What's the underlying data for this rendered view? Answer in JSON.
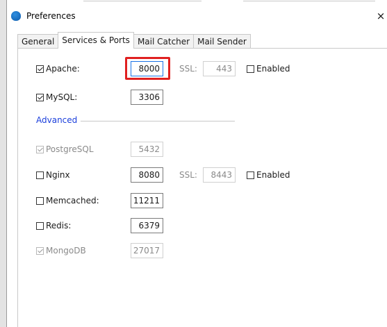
{
  "window": {
    "title": "Preferences",
    "close_glyph": "×",
    "app_icon": "app-logo-icon"
  },
  "tabs": [
    {
      "label": "General",
      "active": false
    },
    {
      "label": "Services & Ports",
      "active": true
    },
    {
      "label": "Mail Catcher",
      "active": false
    },
    {
      "label": "Mail Sender",
      "active": false
    }
  ],
  "services": {
    "apache": {
      "label": "Apache:",
      "checked": true,
      "port": "8000",
      "ssl_label": "SSL:",
      "ssl_port": "443",
      "enabled_label": "Enabled",
      "ssl_enabled": false
    },
    "mysql": {
      "label": "MySQL:",
      "checked": true,
      "port": "3306"
    }
  },
  "advanced": {
    "section_label": "Advanced",
    "postgresql": {
      "label": "PostgreSQL",
      "checked": true,
      "disabled": true,
      "port": "5432"
    },
    "nginx": {
      "label": "Nginx",
      "checked": false,
      "port": "8080",
      "ssl_label": "SSL:",
      "ssl_port": "8443",
      "enabled_label": "Enabled",
      "ssl_enabled": false
    },
    "memcached": {
      "label": "Memcached:",
      "checked": false,
      "port": "11211"
    },
    "redis": {
      "label": "Redis:",
      "checked": false,
      "port": "6379"
    },
    "mongodb": {
      "label": "MongoDB",
      "checked": true,
      "disabled": true,
      "port": "27017"
    }
  },
  "colors": {
    "highlight": "#e02020",
    "section_label": "#1a3edc",
    "focus": "#1a73e8"
  }
}
